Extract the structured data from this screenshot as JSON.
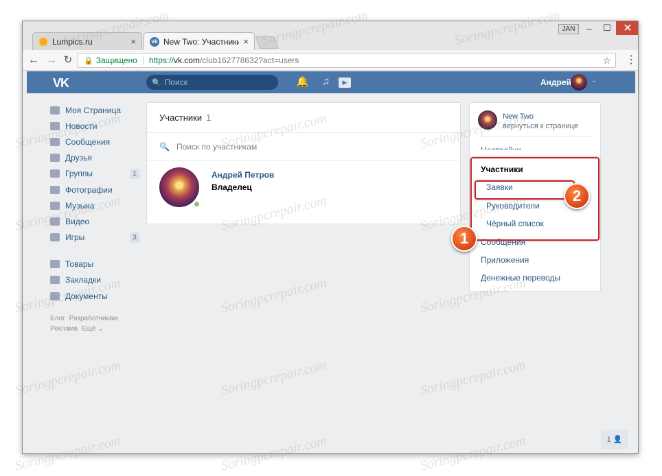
{
  "browser": {
    "tabs": [
      {
        "title": "Lumpics.ru",
        "close": "×"
      },
      {
        "title": "New Two: Участники",
        "close": "×"
      }
    ],
    "user_badge": "JAN",
    "window_controls": {
      "minimize": "–",
      "maximize": "☐",
      "close": "✕"
    },
    "address": {
      "secure_label": "Защищено",
      "url_scheme": "https://",
      "url_host": "vk.com",
      "url_path": "/club162778632?act=users"
    }
  },
  "vk_header": {
    "logo": "VK",
    "search_placeholder": "Поиск",
    "user_name": "Андрей",
    "brand_color": "#4a76a8"
  },
  "left_menu": {
    "items": [
      {
        "label": "Моя Страница",
        "icon": "home-icon"
      },
      {
        "label": "Новости",
        "icon": "news-icon"
      },
      {
        "label": "Сообщения",
        "icon": "messages-icon"
      },
      {
        "label": "Друзья",
        "icon": "friends-icon"
      },
      {
        "label": "Группы",
        "icon": "groups-icon",
        "count": "1"
      },
      {
        "label": "Фотографии",
        "icon": "camera-icon"
      },
      {
        "label": "Музыка",
        "icon": "music-icon"
      },
      {
        "label": "Видео",
        "icon": "video-icon"
      },
      {
        "label": "Игры",
        "icon": "gamepad-icon",
        "count": "3"
      },
      {
        "label": "Товары",
        "icon": "bag-icon"
      },
      {
        "label": "Закладки",
        "icon": "star-icon"
      },
      {
        "label": "Документы",
        "icon": "document-icon"
      }
    ],
    "footer": [
      "Блог",
      "Разработчикам",
      "Реклама",
      "Ещё ⌄"
    ]
  },
  "members": {
    "title": "Участники",
    "count": "1",
    "search_placeholder": "Поиск по участникам",
    "list": [
      {
        "name": "Андрей Петров",
        "role": "Владелец"
      }
    ]
  },
  "right_menu": {
    "group_name": "New Two",
    "back_label": "вернуться к странице",
    "items": {
      "settings": "Настройки",
      "members": "Участники",
      "requests": "Заявки",
      "managers": "Руководители",
      "blacklist": "Чёрный список",
      "messages": "Сообщения",
      "apps": "Приложения",
      "transfers": "Денежные переводы"
    }
  },
  "annotations": {
    "badge1": "1",
    "badge2": "2",
    "highlight_color": "#c7242b"
  },
  "corner_button": "1 👤",
  "watermark": "Soringpcrepair.com"
}
